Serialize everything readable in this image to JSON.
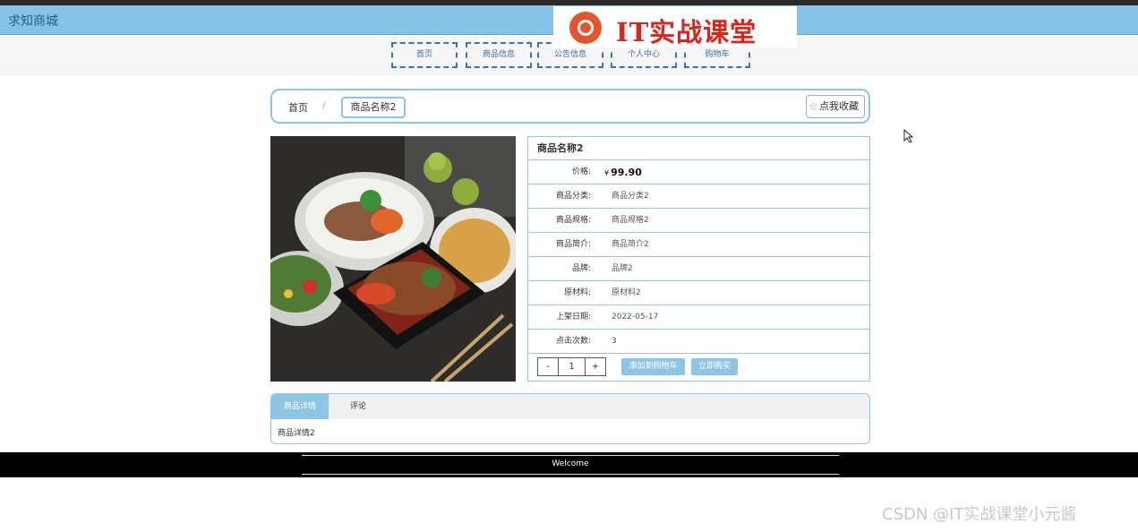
{
  "header": {
    "site_title": "求知商城"
  },
  "brand": {
    "text": "IT实战课堂"
  },
  "nav": {
    "items": [
      "首页",
      "商品信息",
      "公告信息",
      "个人中心",
      "购物车"
    ]
  },
  "breadcrumb": {
    "home": "首页",
    "separator": "/",
    "current": "商品名称2"
  },
  "favorite": {
    "label": "点我收藏"
  },
  "product": {
    "title": "商品名称2",
    "price_label": "价格:",
    "currency": "¥",
    "price": "99.90",
    "rows": [
      {
        "label": "商品分类:",
        "value": "商品分类2"
      },
      {
        "label": "商品规格:",
        "value": "商品规格2"
      },
      {
        "label": "商品简介:",
        "value": "商品简介2"
      },
      {
        "label": "品牌:",
        "value": "品牌2"
      },
      {
        "label": "原材料:",
        "value": "原材料2"
      },
      {
        "label": "上架日期:",
        "value": "2022-05-17"
      },
      {
        "label": "点击次数:",
        "value": "3"
      }
    ],
    "quantity": {
      "minus": "-",
      "value": "1",
      "plus": "+"
    },
    "add_to_cart": "添加到购物车",
    "buy_now": "立即购买"
  },
  "tabs": {
    "items": [
      "商品详情",
      "评论"
    ],
    "content": "商品详情2"
  },
  "footer": {
    "text": "Welcome"
  },
  "watermark": "CSDN @IT实战课堂小元酱",
  "colors": {
    "accent": "#8ec5e4",
    "header": "#87c3e6",
    "nav_border": "#3a74b8",
    "brand_red": "#d8261c"
  }
}
